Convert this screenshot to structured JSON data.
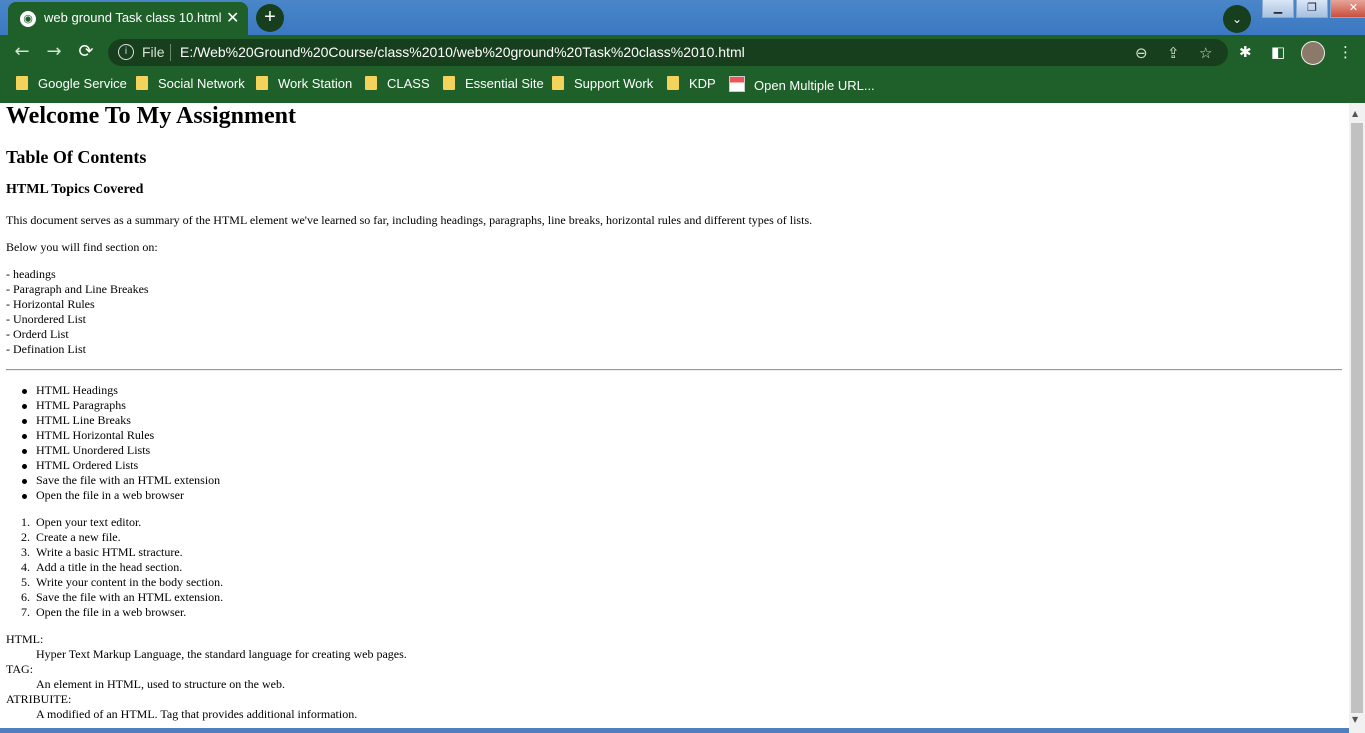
{
  "browser": {
    "tab_title": "web ground Task class 10.html",
    "tab_close": "✕",
    "new_tab": "+",
    "tab_search": "⌄",
    "window_controls": {
      "minimize": "▁",
      "restore": "❐",
      "close": "✕"
    },
    "nav": {
      "back": "←",
      "forward": "→",
      "reload": "⟳"
    },
    "address": {
      "scheme_label": "File",
      "url": "E:/Web%20Ground%20Course/class%2010/web%20ground%20Task%20class%2010.html"
    },
    "toolbar_icons": {
      "zoom": "⊖",
      "share": "⇪",
      "bookmark": "☆",
      "extensions": "✱",
      "side_panel": "◧",
      "menu": "⋮"
    },
    "bookmarks": [
      "Google Service",
      "Social Network",
      "Work Station",
      "CLASS",
      "Essential Site",
      "Support Work",
      "KDP",
      "Open Multiple URL..."
    ]
  },
  "page": {
    "h1": "Welcome To My Assignment",
    "h2": "Table Of Contents",
    "h3": "HTML Topics Covered",
    "intro": "This document serves as a summary of the HTML element we've learned so far, including headings, paragraphs, line breaks, horizontal rules and different types of lists.",
    "below": "Below you will find section on:",
    "sections": [
      "- headings",
      "- Paragraph and Line Breakes",
      "- Horizontal Rules",
      "- Unordered List",
      "- Orderd List",
      "- Defination List"
    ],
    "unordered": [
      "HTML Headings",
      "HTML Paragraphs",
      "HTML Line Breaks",
      "HTML Horizontal Rules",
      "HTML Unordered Lists",
      "HTML Ordered Lists",
      "Save the file with an HTML extension",
      "Open the file in a web browser"
    ],
    "ordered": [
      "Open your text editor.",
      "Create a new file.",
      "Write a basic HTML stracture.",
      "Add a title in the head section.",
      "Write your content in the body section.",
      "Save the file with an HTML extension.",
      "Open the file in a web browser."
    ],
    "definitions": [
      {
        "term": "HTML:",
        "desc": "Hyper Text Markup Language, the standard language for creating web pages."
      },
      {
        "term": "TAG:",
        "desc": "An element in HTML, used to structure on the web."
      },
      {
        "term": "ATRIBUITE:",
        "desc": "A modified of an HTML. Tag that provides additional information."
      }
    ]
  },
  "colors": {
    "chrome": "#1f5f2a",
    "tabstrip": "#3b78c2",
    "omnibox": "#173f1d"
  }
}
